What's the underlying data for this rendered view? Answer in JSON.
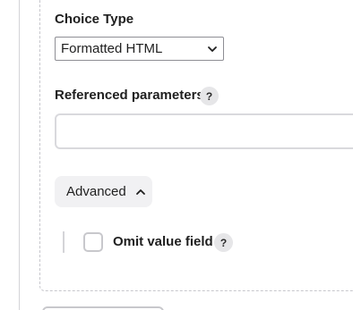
{
  "choice_type": {
    "label": "Choice Type",
    "selected": "Formatted HTML",
    "chevron_icon": "chevron-down-icon"
  },
  "referenced_parameters": {
    "label": "Referenced parameters",
    "help": "?",
    "value": ""
  },
  "advanced": {
    "label": "Advanced",
    "chevron_icon": "chevron-up-icon"
  },
  "omit_value_field": {
    "label": "Omit value field",
    "help": "?",
    "checked": false
  },
  "colors": {
    "text": "#1f1f1f",
    "border": "#c6c6cc",
    "help_bg": "#e6e6e8",
    "button_bg": "#f1f1f3"
  }
}
